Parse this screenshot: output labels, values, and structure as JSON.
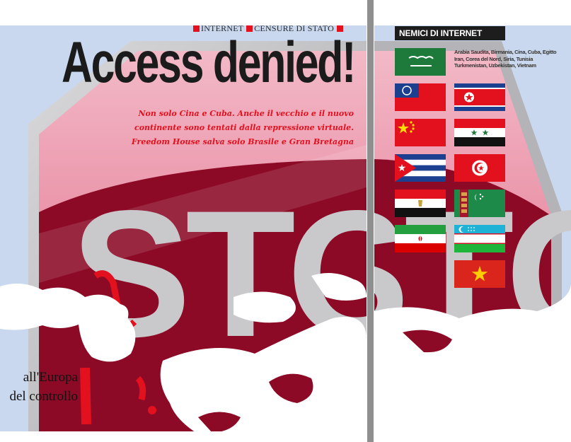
{
  "article": {
    "kicker": [
      {
        "label": "INTERNET"
      },
      {
        "label": "CENSURE DI STATO"
      }
    ],
    "title": "Access denied!",
    "standfirst": [
      "Non solo Cina e Cuba. Anche il vecchio e il nuovo",
      "continente sono tentati dalla repressione virtuale.",
      "Freedom House salva solo Brasile e Gran Bretagna"
    ],
    "stop_sign_text": "STOP",
    "body_fragment": [
      "all'Europa",
      "del controllo"
    ]
  },
  "sidebar": {
    "title": "NEMICI DI INTERNET",
    "countries_text": [
      "Arabia Saudita, Birmania, Cina, Cuba, Egitto",
      "Iran, Corea del Nord, Siria, Tunisia",
      "Turkmenistan, Uzbekistan, Vietnam"
    ],
    "flags": [
      {
        "icon": "saudi-arabia-flag-icon"
      },
      {
        "icon": "burma-flag-icon"
      },
      {
        "icon": "north-korea-flag-icon"
      },
      {
        "icon": "china-flag-icon"
      },
      {
        "icon": "syria-flag-icon"
      },
      {
        "icon": "cuba-flag-icon"
      },
      {
        "icon": "tunisia-flag-icon"
      },
      {
        "icon": "egypt-flag-icon"
      },
      {
        "icon": "turkmenistan-flag-icon"
      },
      {
        "icon": "iran-flag-icon"
      },
      {
        "icon": "uzbekistan-flag-icon"
      },
      {
        "icon": "vietnam-flag-icon"
      }
    ]
  },
  "colors": {
    "accent_red": "#e3101e",
    "stop_red": "#8c0a26",
    "sky_blue": "#c9d8ee",
    "title_black": "#1b1b1b"
  }
}
